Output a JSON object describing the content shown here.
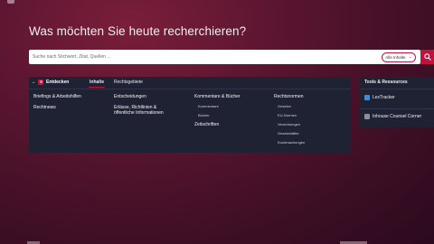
{
  "hero": {
    "title": "Was möchten Sie heute recherchieren?"
  },
  "search": {
    "placeholder": "Suche nach Stichwort, Zitat, Quellen ...",
    "scope_label": "Alle Inhalte"
  },
  "tabs": {
    "discover": "Entdecken",
    "content": "Inhalte",
    "legal_areas": "Rechtsgebiete"
  },
  "columns": {
    "col1": {
      "items": [
        "Briefings & Arbeitshilfen",
        "Rechtnews"
      ]
    },
    "col2": {
      "items": [
        "Entscheidungen",
        "Erlässe, Richtlinien &",
        "öffentliche Informationen"
      ]
    },
    "col3": {
      "heading": "Kommentare & Bücher",
      "subs": [
        "Kommentare",
        "Bücher"
      ],
      "extra": "Zeitschriften"
    },
    "col4": {
      "heading": "Rechtsnormen",
      "subs": [
        "Gesetze",
        "EU-Normen",
        "Verordnungen",
        "Gesetzblätter",
        "Kundmachungen"
      ]
    }
  },
  "tools": {
    "title": "Tools & Ressources",
    "items": [
      "LexTracker",
      "Inhouse Counsel Corner"
    ]
  },
  "colors": {
    "accent": "#c0123c",
    "panel": "#1f2233"
  }
}
